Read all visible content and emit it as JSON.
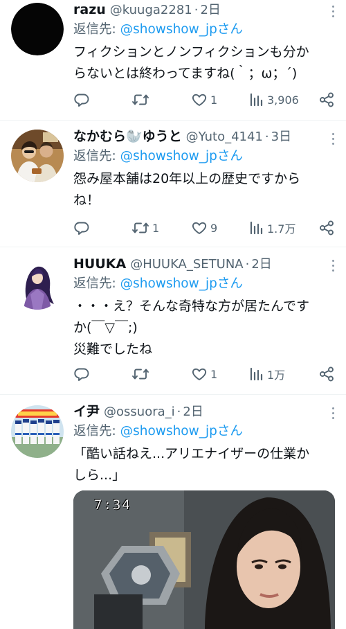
{
  "tweets": [
    {
      "name": "razu",
      "handle": "@kuuga2281",
      "sep": "·",
      "time": "2日",
      "reply_prefix": "返信先: ",
      "reply_mention": "@showshow_jpさん",
      "text": "フィクションとノンフィクションも分か\nらないとは終わってますね(｀；ω；´)",
      "replies": "",
      "retweets": "",
      "likes": "1",
      "views": "3,906"
    },
    {
      "name": "なかむら🦭ゆうと",
      "handle": "@Yuto_4141",
      "sep": "·",
      "time": "3日",
      "reply_prefix": "返信先: ",
      "reply_mention": "@showshow_jpさん",
      "text": "怨み屋本舗は20年以上の歴史ですから\nね！",
      "replies": "",
      "retweets": "1",
      "likes": "9",
      "views": "1.7万"
    },
    {
      "name": "HUUKA",
      "handle": "@HUUKA_SETUNA",
      "sep": "·",
      "time": "2日",
      "reply_prefix": "返信先: ",
      "reply_mention": "@showshow_jpさん",
      "text": "・・・え？そんな奇特な方が居たんです\nか(￣▽￣;)\n災難でしたね",
      "replies": "",
      "retweets": "",
      "likes": "1",
      "views": "1万"
    },
    {
      "name": "イ尹",
      "handle": "@ossuora_i",
      "sep": "·",
      "time": "2日",
      "reply_prefix": "返信先: ",
      "reply_mention": "@showshow_jpさん",
      "text": "「酷い話ねえ...アリエナイザーの仕業か\nしら...」",
      "media_time": "7:34"
    }
  ],
  "colors": {
    "accent": "#1d9bf0",
    "secondary_text": "#536471",
    "primary_text": "#0f1419",
    "divider": "#eff3f4"
  },
  "icons": {
    "reply": "reply-icon",
    "retweet": "retweet-icon",
    "like": "heart-icon",
    "views": "views-icon",
    "share": "share-icon",
    "more": "more-vertical-icon"
  }
}
